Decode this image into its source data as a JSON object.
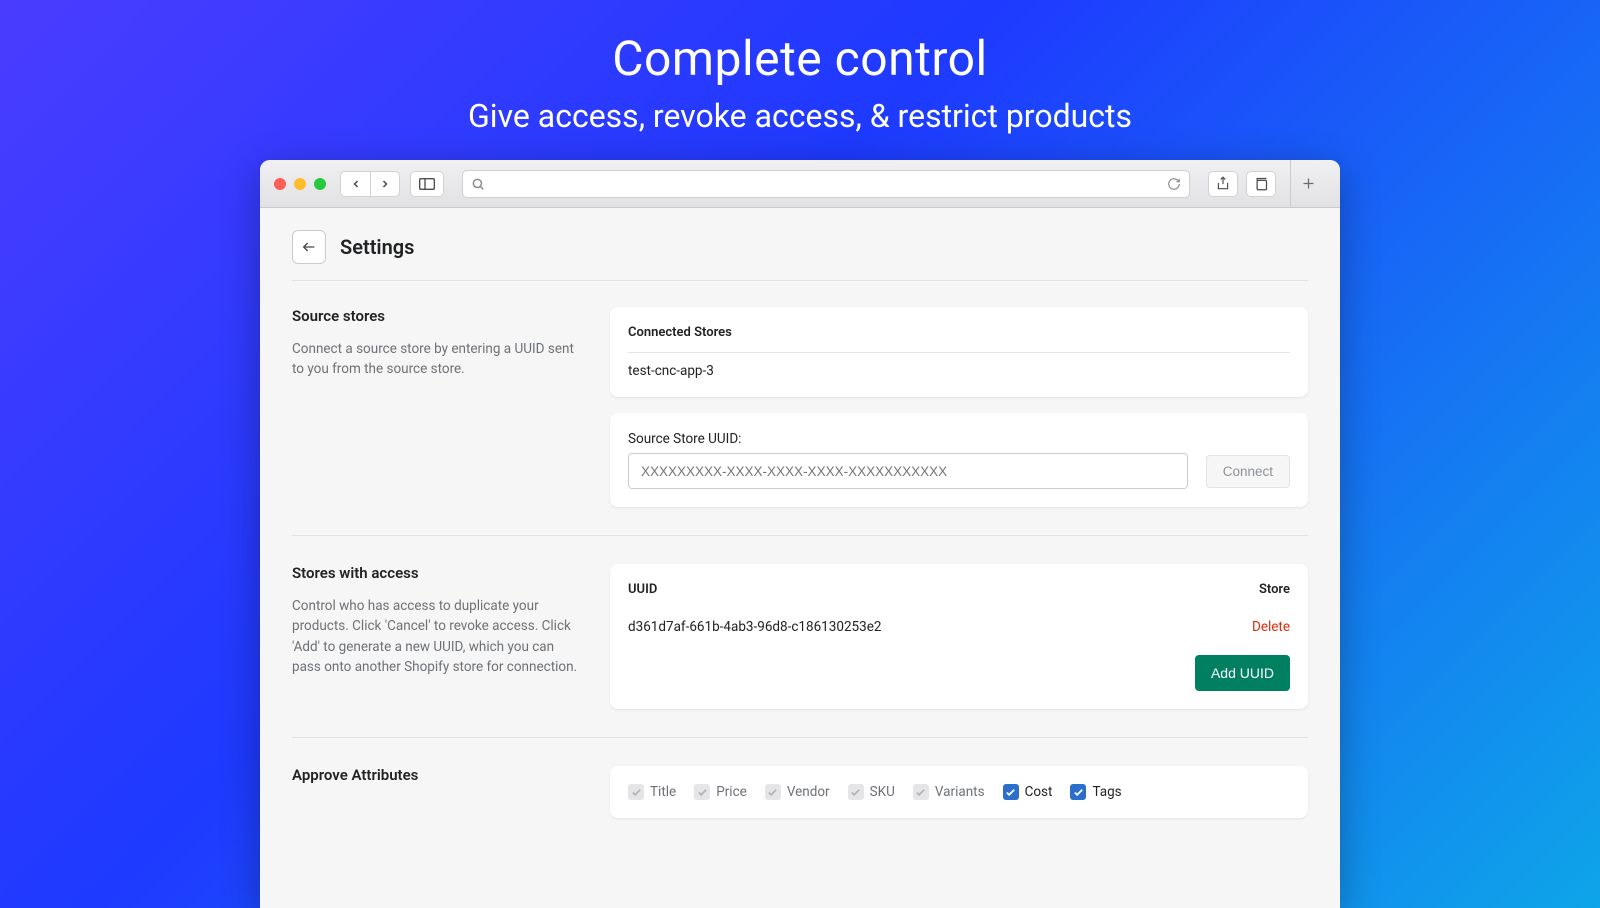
{
  "hero": {
    "title": "Complete control",
    "subtitle": "Give access, revoke access, & restrict products"
  },
  "page": {
    "title": "Settings"
  },
  "sourceStores": {
    "heading": "Source stores",
    "description": "Connect a source store by entering a UUID sent to you from the source store.",
    "connectedLabel": "Connected Stores",
    "connectedStore": "test-cnc-app-3",
    "uuidLabel": "Source Store UUID:",
    "uuidPlaceholder": "XXXXXXXXX-XXXX-XXXX-XXXX-XXXXXXXXXXX",
    "connectLabel": "Connect"
  },
  "storesAccess": {
    "heading": "Stores with access",
    "description": "Control who has access to duplicate your products. Click 'Cancel' to revoke access. Click 'Add' to generate a new UUID, which you can pass onto another Shopify store for connection.",
    "colUuid": "UUID",
    "colStore": "Store",
    "row": {
      "uuid": "d361d7af-661b-4ab3-96d8-c186130253e2",
      "deleteLabel": "Delete"
    },
    "addLabel": "Add UUID"
  },
  "attributes": {
    "heading": "Approve Attributes",
    "items": [
      {
        "label": "Title",
        "locked": true,
        "checked": true
      },
      {
        "label": "Price",
        "locked": true,
        "checked": true
      },
      {
        "label": "Vendor",
        "locked": true,
        "checked": true
      },
      {
        "label": "SKU",
        "locked": true,
        "checked": true
      },
      {
        "label": "Variants",
        "locked": true,
        "checked": true
      },
      {
        "label": "Cost",
        "locked": false,
        "checked": true
      },
      {
        "label": "Tags",
        "locked": false,
        "checked": true
      }
    ]
  }
}
